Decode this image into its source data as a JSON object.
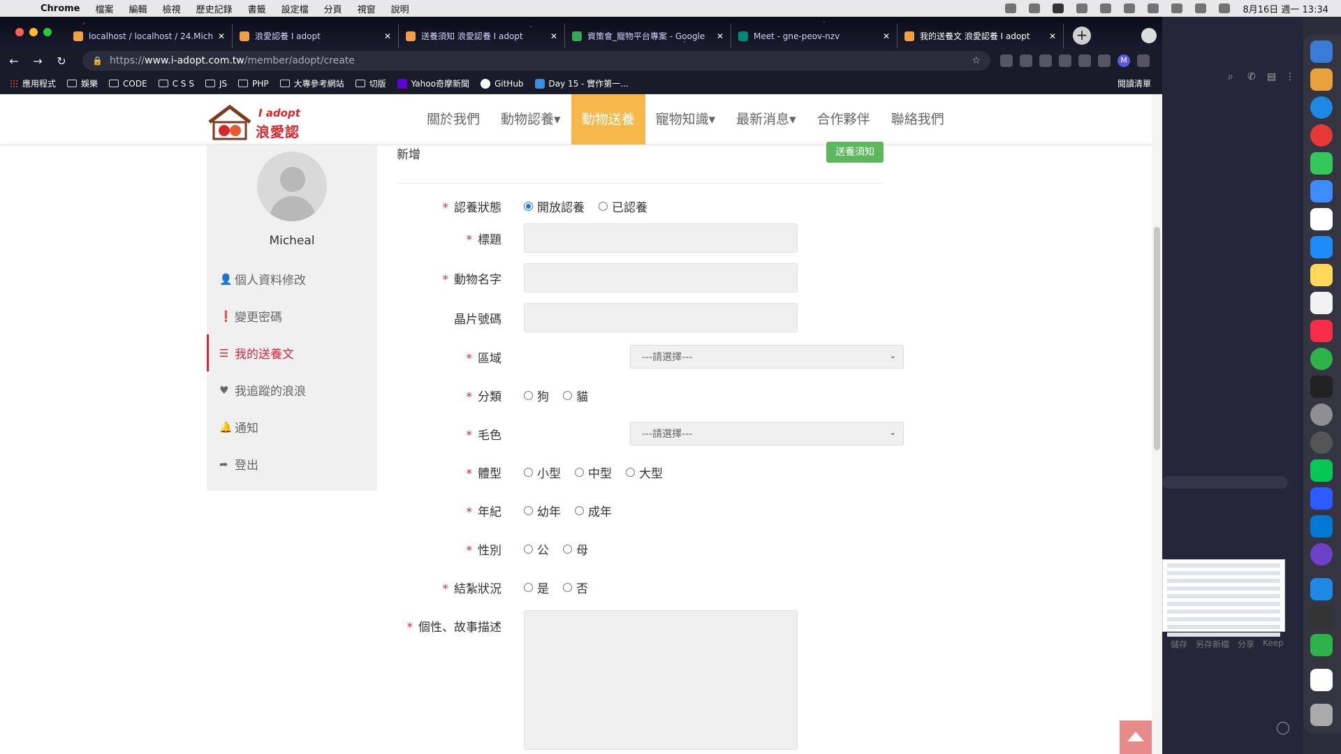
{
  "menubar": {
    "app": "Chrome",
    "items": [
      "檔案",
      "編輯",
      "檢視",
      "歷史記錄",
      "書籤",
      "設定檔",
      "分頁",
      "視窗",
      "說明"
    ],
    "clock": "8月16日 週一  13:34"
  },
  "browser": {
    "tabs": [
      {
        "title": "localhost / localhost / 24.Miche"
      },
      {
        "title": "浪愛認養 I adopt"
      },
      {
        "title": "送養須知 浪愛認養 I adopt"
      },
      {
        "title": "資策會_寵物平台專案 - Google"
      },
      {
        "title": "Meet - gne-peov-nzv"
      },
      {
        "title": "我的送養文 浪愛認養 I adopt"
      }
    ],
    "url_scheme": "https://",
    "url_host": "www.i-adopt.com.tw",
    "url_path": "/member/adopt/create",
    "bookmarks": [
      "應用程式",
      "娛樂",
      "CODE",
      "C S S",
      "JS",
      "PHP",
      "大專參考網站",
      "切版",
      "Yahoo奇摩新聞",
      "GitHub",
      "Day 15 - 實作第一..."
    ],
    "reading_list": "閱讀清單",
    "profile_initial": "M"
  },
  "site": {
    "logo_top": "I adopt",
    "logo_bottom": "浪愛認養",
    "nav": [
      "關於我們",
      "動物認養▾",
      "動物送養",
      "寵物知識▾",
      "最新消息▾",
      "合作夥伴",
      "聯絡我們"
    ]
  },
  "sidebar": {
    "username": "Micheal",
    "items": [
      {
        "label": "個人資料修改",
        "icon": "user-icon"
      },
      {
        "label": "變更密碼",
        "icon": "alert-circle-icon"
      },
      {
        "label": "我的送養文",
        "icon": "list-icon"
      },
      {
        "label": "我追蹤的浪浪",
        "icon": "heart-icon"
      },
      {
        "label": "通知",
        "icon": "bell-icon"
      },
      {
        "label": "登出",
        "icon": "share-arrow-icon"
      }
    ]
  },
  "form": {
    "title": "新增",
    "notice_button": "送養須知",
    "status": {
      "label": "認養狀態",
      "options": [
        "開放認養",
        "已認養"
      ]
    },
    "title_field": {
      "label": "標題",
      "value": ""
    },
    "name_field": {
      "label": "動物名字",
      "value": ""
    },
    "chip_field": {
      "label": "晶片號碼",
      "value": ""
    },
    "area": {
      "label": "區域",
      "selected": "---請選擇---"
    },
    "category": {
      "label": "分類",
      "options": [
        "狗",
        "貓"
      ]
    },
    "color": {
      "label": "毛色",
      "selected": "---請選擇---"
    },
    "size": {
      "label": "體型",
      "options": [
        "小型",
        "中型",
        "大型"
      ]
    },
    "age": {
      "label": "年紀",
      "options": [
        "幼年",
        "成年"
      ]
    },
    "gender": {
      "label": "性別",
      "options": [
        "公",
        "母"
      ]
    },
    "neutered": {
      "label": "結紮狀況",
      "options": [
        "是",
        "否"
      ]
    },
    "story": {
      "label": "個性、故事描述",
      "value": ""
    }
  },
  "background_app": {
    "actions": [
      "儲存",
      "另存新檔",
      "分享",
      "Keep"
    ]
  },
  "colors": {
    "accent_nav": "#f7b84b",
    "active_sidebar": "#d9263f",
    "notice_button": "#5cb85c",
    "required_mark": "#d9263f"
  }
}
